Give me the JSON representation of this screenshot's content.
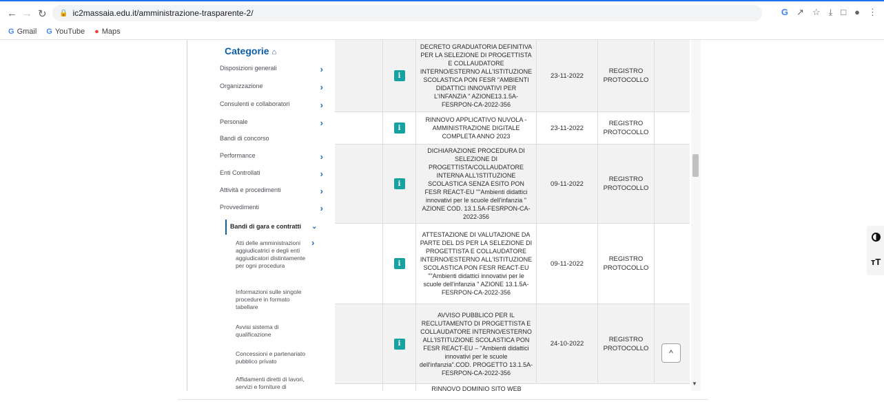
{
  "browser": {
    "url": "ic2massaia.edu.it/amministrazione-trasparente-2/",
    "bookmarks": [
      "Gmail",
      "YouTube",
      "Maps"
    ]
  },
  "sidebar": {
    "title": "Categorie",
    "items": [
      "Disposizioni generali",
      "Organizzazione",
      "Consulenti e collaboratori",
      "Personale",
      "Bandi di concorso",
      "Performance",
      "Enti Controllati",
      "Attività e procedimenti",
      "Provvedimenti"
    ],
    "active_item": "Bandi di gara e contratti",
    "sub_items": [
      "Atti delle amministrazioni aggiudicatrici e degli enti aggiudicatori distintamente per ogni procedura",
      "Informazioni sulle singole procedure in formato tabellare",
      "Avvisi sistema di qualificazione",
      "Concessioni e partenariato pubblico privato",
      "Affidamenti diretti di lavori, servizi e forniture di"
    ]
  },
  "table": {
    "rows": [
      {
        "title": "DECRETO GRADUATORIA DEFINITIVA PER LA SELEZIONE DI PROGETTISTA E COLLAUDATORE INTERNO/ESTERNO ALL'ISTITUZIONE SCOLASTICA PON FESR \"AMBIENTI DIDATTICI INNOVATIVI PER L'INFANZIA \" AZIONE13.1.5A-FESRPON-CA-2022-356",
        "date": "23-11-2022",
        "register": "REGISTRO PROTOCOLLO"
      },
      {
        "title": "RINNOVO APPLICATIVO NUVOLA - AMMINISTRAZIONE DIGITALE COMPLETA ANNO 2023",
        "date": "23-11-2022",
        "register": "REGISTRO PROTOCOLLO"
      },
      {
        "title": "DICHIARAZIONE PROCEDURA DI SELEZIONE DI PROGETTISTA/COLLAUDATORE INTERNA ALL'ISTITUZIONE SCOLASTICA SENZA ESITO PON FESR REACT-EU \"\"Ambienti didattici innovativi per le scuole dell'infanzia \" AZIONE COD. 13.1.5A-FESRPON-CA-2022-356",
        "date": "09-11-2022",
        "register": "REGISTRO PROTOCOLLO"
      },
      {
        "title": "ATTESTAZIONE DI VALUTAZIONE DA PARTE DEL DS PER LA SELEZIONE DI PROGETTISTA E COLLAUDATORE INTERNO/ESTERNO ALL'ISTITUZIONE SCOLASTICA PON FESR REACT-EU \"\"Ambienti didattici innovativi per le scuole dell'infanzia \" AZIONE 13.1.5A-FESRPON-CA-2022-356",
        "date": "09-11-2022",
        "register": "REGISTRO PROTOCOLLO"
      },
      {
        "title": "AVVISO PUBBLICO PER IL RECLUTAMENTO DI PROGETTISTA E COLLAUDATORE INTERNO/ESTERNO ALL'ISTITUZIONE SCOLASTICA PON FESR REACT-EU – \"Ambienti didattici innovativi per le scuole dell'infanzia\".COD. PROGETTO 13.1.5A-FESRPON-CA-2022-356",
        "date": "24-10-2022",
        "register": "REGISTRO PROTOCOLLO"
      }
    ],
    "partial_row_title": "RINNOVO DOMINIO SITO WEB"
  },
  "icons": {
    "info": "i",
    "back_to_top": "^",
    "text_size": "тT"
  }
}
